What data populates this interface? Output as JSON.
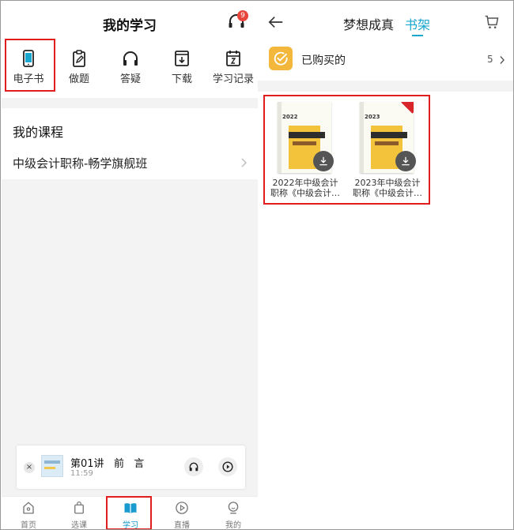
{
  "left": {
    "title": "我的学习",
    "support_badge": "9",
    "grid": [
      {
        "label": "电子书",
        "icon": "phone-icon"
      },
      {
        "label": "做题",
        "icon": "clipboard-edit-icon"
      },
      {
        "label": "答疑",
        "icon": "headphones-icon"
      },
      {
        "label": "下载",
        "icon": "download-folder-icon"
      },
      {
        "label": "学习记录",
        "icon": "calendar-icon"
      }
    ],
    "course_section_title": "我的课程",
    "course_name": "中级会计职称-畅学旗舰班",
    "player": {
      "close": "×",
      "title": "第01讲   前   言",
      "time": "11:59"
    },
    "tabs": [
      {
        "label": "首页",
        "icon": "home-icon"
      },
      {
        "label": "选课",
        "icon": "shopping-bag-icon"
      },
      {
        "label": "学习",
        "icon": "open-book-icon"
      },
      {
        "label": "直播",
        "icon": "play-circle-icon"
      },
      {
        "label": "我的",
        "icon": "profile-icon"
      }
    ],
    "active_tab": "学习"
  },
  "right": {
    "tabs": [
      "梦想成真",
      "书架"
    ],
    "active_tab": "书架",
    "purchased_label": "已购买的",
    "purchased_count": "5",
    "books": [
      {
        "title_line1": "2022年中级会计",
        "title_line2": "职称《中级会计…",
        "cover_year": "2022"
      },
      {
        "title_line1": "2023年中级会计",
        "title_line2": "职称《中级会计…",
        "cover_year": "2023"
      }
    ]
  },
  "colors": {
    "accent": "#19a6cf",
    "highlight": "#e01e1e",
    "purchased_icon": "#f3b73c",
    "badge": "#e8453c"
  }
}
